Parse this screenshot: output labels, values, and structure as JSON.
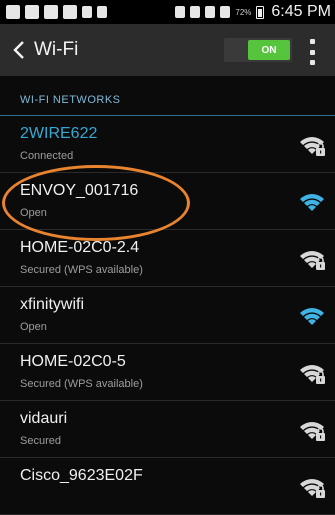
{
  "status_bar": {
    "battery_percent": "72%",
    "time": "6:45 PM"
  },
  "action_bar": {
    "title": "Wi-Fi",
    "toggle_label": "ON",
    "toggle_on": true
  },
  "section_header": "WI-FI NETWORKS",
  "networks": [
    {
      "name": "2WIRE622",
      "status": "Connected",
      "secured": true,
      "connected": true
    },
    {
      "name": "ENVOY_001716",
      "status": "Open",
      "secured": false,
      "highlighted": true
    },
    {
      "name": "HOME-02C0-2.4",
      "status": "Secured (WPS available)",
      "secured": true
    },
    {
      "name": "xfinitywifi",
      "status": "Open",
      "secured": false
    },
    {
      "name": "HOME-02C0-5",
      "status": "Secured (WPS available)",
      "secured": true
    },
    {
      "name": "vidauri",
      "status": "Secured",
      "secured": true
    },
    {
      "name": "Cisco_9623E02F",
      "status": "",
      "secured": true
    }
  ],
  "colors": {
    "accent_blue": "#35a8d4",
    "toggle_green": "#57c43d",
    "highlight_orange": "#e8832f",
    "open_wifi_blue": "#3fb3e3",
    "secured_wifi_white": "#d8d8d8"
  }
}
